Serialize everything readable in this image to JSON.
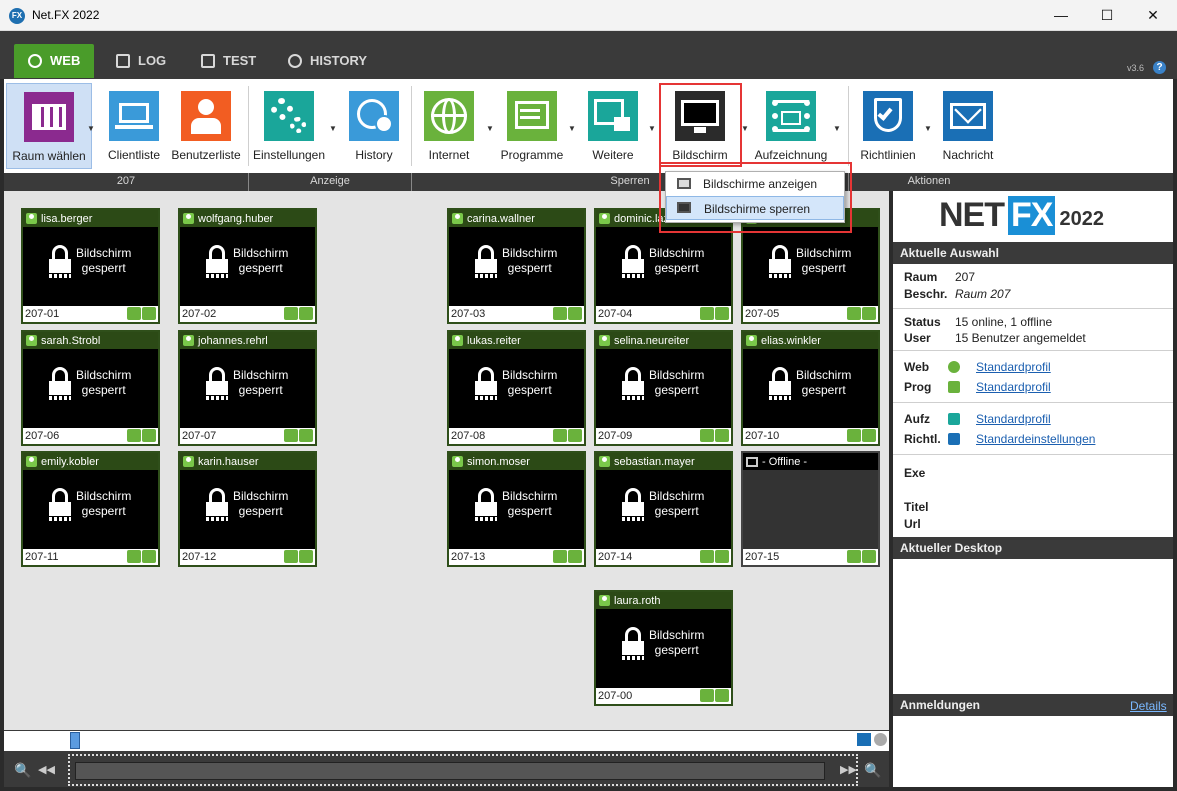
{
  "window": {
    "title": "Net.FX 2022",
    "app_icon": "FX",
    "minimize": "—",
    "maximize": "☐",
    "close": "✕"
  },
  "tabs": [
    {
      "label": "WEB",
      "active": true
    },
    {
      "label": "LOG",
      "active": false
    },
    {
      "label": "TEST",
      "active": false
    },
    {
      "label": "HISTORY",
      "active": false
    }
  ],
  "version": "v3.6",
  "help": "?",
  "ribbon": {
    "buttons": [
      {
        "label": "Raum wählen",
        "color": "#8b2a8f"
      },
      {
        "label": "Clientliste",
        "color": "#3a9ad9"
      },
      {
        "label": "Benutzerliste",
        "color": "#f25d22"
      },
      {
        "label": "Einstellungen",
        "color": "#1aa69a"
      },
      {
        "label": "History",
        "color": "#3a9ad9"
      },
      {
        "label": "Internet",
        "color": "#6ab23c"
      },
      {
        "label": "Programme",
        "color": "#6ab23c"
      },
      {
        "label": "Weitere",
        "color": "#1aa69a"
      },
      {
        "label": "Bildschirm",
        "color": "#2b2b2b"
      },
      {
        "label": "Aufzeichnung",
        "color": "#1aa69a"
      },
      {
        "label": "Richtlinien",
        "color": "#1a6fb5"
      },
      {
        "label": "Nachricht",
        "color": "#1a6fb5"
      }
    ],
    "groups": {
      "room": "207",
      "view": "Anzeige",
      "lock": "Sperren",
      "actions": "Aktionen"
    }
  },
  "dropdown": {
    "items": [
      {
        "label": "Bildschirme anzeigen"
      },
      {
        "label": "Bildschirme sperren"
      }
    ]
  },
  "lock_text": {
    "line1": "Bildschirm",
    "line2": "gesperrt"
  },
  "clients": [
    {
      "user": "lisa.berger",
      "id": "207-01"
    },
    {
      "user": "wolfgang.huber",
      "id": "207-02"
    },
    {
      "user": "carina.wallner",
      "id": "207-03"
    },
    {
      "user": "dominic.lazar",
      "id": "207-04"
    },
    {
      "user": "",
      "id": "207-05"
    },
    {
      "user": "sarah.Strobl",
      "id": "207-06"
    },
    {
      "user": "johannes.rehrl",
      "id": "207-07"
    },
    {
      "user": "lukas.reiter",
      "id": "207-08"
    },
    {
      "user": "selina.neureiter",
      "id": "207-09"
    },
    {
      "user": "elias.winkler",
      "id": "207-10"
    },
    {
      "user": "emily.kobler",
      "id": "207-11"
    },
    {
      "user": "karin.hauser",
      "id": "207-12"
    },
    {
      "user": "simon.moser",
      "id": "207-13"
    },
    {
      "user": "sebastian.mayer",
      "id": "207-14"
    },
    {
      "user": "- Offline -",
      "id": "207-15"
    },
    {
      "user": "laura.roth",
      "id": "207-00"
    }
  ],
  "side": {
    "logo": {
      "a": "NET",
      "b": "FX",
      "c": "2022"
    },
    "selection_header": "Aktuelle Auswahl",
    "raum_k": "Raum",
    "raum_v": "207",
    "beschr_k": "Beschr.",
    "beschr_v": "Raum 207",
    "status_k": "Status",
    "status_v": "15 online, 1 offline",
    "user_k": "User",
    "user_v": "15 Benutzer angemeldet",
    "web_k": "Web",
    "web_v": "Standardprofil",
    "prog_k": "Prog",
    "prog_v": "Standardprofil",
    "aufz_k": "Aufz",
    "aufz_v": "Standardprofil",
    "richtl_k": "Richtl.",
    "richtl_v": "Standardeinstellungen",
    "exe_k": "Exe",
    "titel_k": "Titel",
    "url_k": "Url",
    "desktop_header": "Aktueller Desktop",
    "logins_header": "Anmeldungen",
    "details": "Details"
  },
  "nav": {
    "zoom_out": "🔍",
    "rewind": "◀◀",
    "forward": "▶▶",
    "zoom_in": "🔍"
  }
}
